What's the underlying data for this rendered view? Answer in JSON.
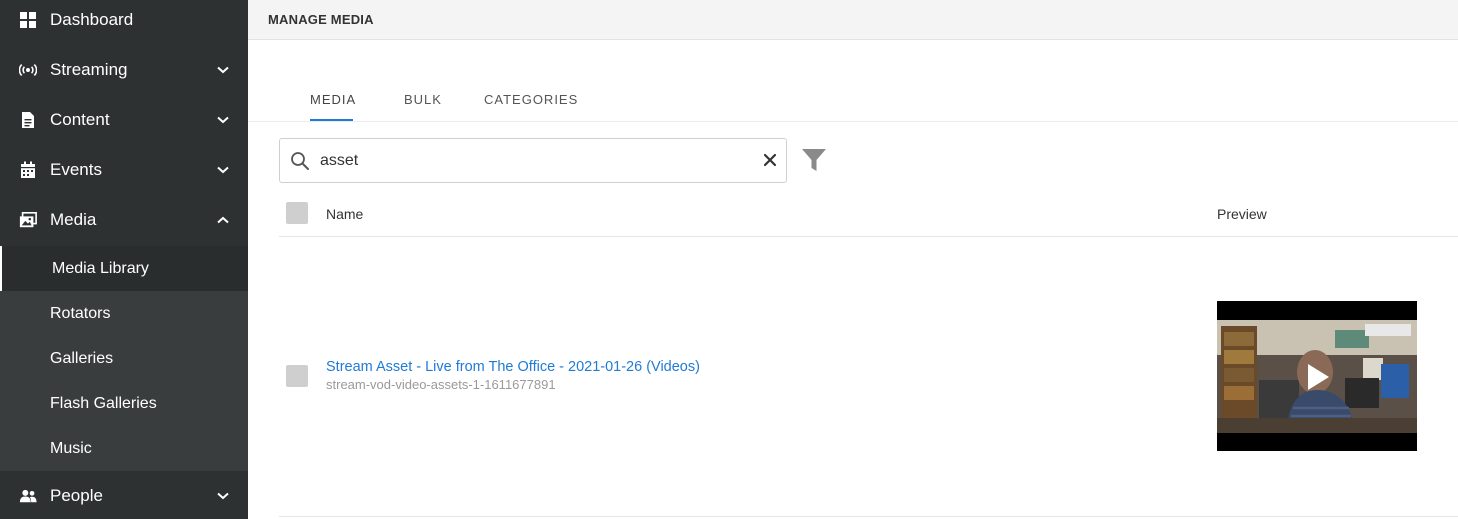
{
  "sidebar": {
    "items": [
      {
        "label": "Dashboard",
        "icon": "grid-icon"
      },
      {
        "label": "Streaming",
        "icon": "broadcast-icon"
      },
      {
        "label": "Content",
        "icon": "document-icon"
      },
      {
        "label": "Events",
        "icon": "calendar-icon"
      },
      {
        "label": "Media",
        "icon": "images-icon"
      },
      {
        "label": "People",
        "icon": "users-icon"
      }
    ],
    "media_submenu": [
      {
        "label": "Media Library"
      },
      {
        "label": "Rotators"
      },
      {
        "label": "Galleries"
      },
      {
        "label": "Flash Galleries"
      },
      {
        "label": "Music"
      }
    ]
  },
  "header": {
    "title": "MANAGE MEDIA"
  },
  "tabs": [
    {
      "label": "MEDIA"
    },
    {
      "label": "BULK"
    },
    {
      "label": "CATEGORIES"
    }
  ],
  "search": {
    "value": "asset"
  },
  "table": {
    "headers": {
      "name": "Name",
      "preview": "Preview"
    },
    "rows": [
      {
        "title": "Stream Asset - Live from The Office - 2021-01-26 (Videos)",
        "subtitle": "stream-vod-video-assets-1-1611677891"
      }
    ]
  },
  "colors": {
    "sidebar_bg": "#2e3131",
    "submenu_bg": "#3a3d3d",
    "accent": "#1f7bd6"
  }
}
